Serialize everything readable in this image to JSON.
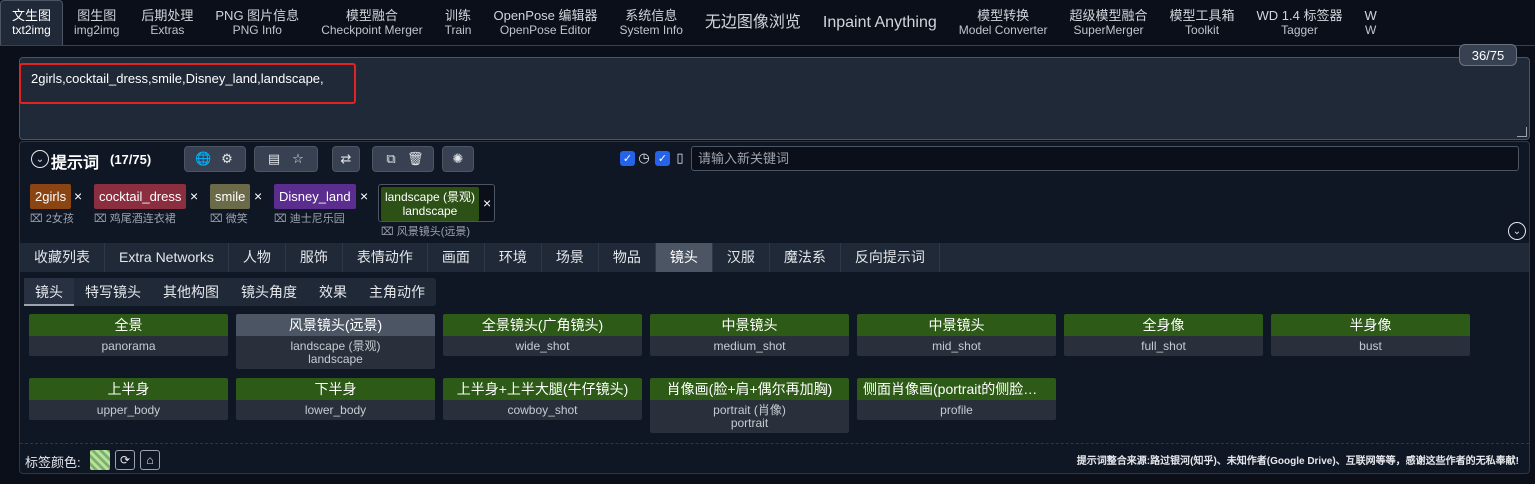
{
  "tabs": [
    {
      "l1": "文生图",
      "l2": "txt2img",
      "active": true
    },
    {
      "l1": "图生图",
      "l2": "img2img"
    },
    {
      "l1": "后期处理",
      "l2": "Extras"
    },
    {
      "l1": "PNG 图片信息",
      "l2": "PNG Info"
    },
    {
      "l1": "模型融合",
      "l2": "Checkpoint Merger"
    },
    {
      "l1": "训练",
      "l2": "Train"
    },
    {
      "l1": "OpenPose 编辑器",
      "l2": "OpenPose Editor"
    },
    {
      "l1": "系统信息",
      "l2": "System Info"
    },
    {
      "l1": "无边图像浏览",
      "l2": ""
    },
    {
      "l1": "Inpaint Anything",
      "l2": ""
    },
    {
      "l1": "模型转换",
      "l2": "Model Converter"
    },
    {
      "l1": "超级模型融合",
      "l2": "SuperMerger"
    },
    {
      "l1": "模型工具箱",
      "l2": "Toolkit"
    },
    {
      "l1": "WD 1.4 标签器",
      "l2": "Tagger"
    },
    {
      "l1": "W",
      "l2": "W"
    }
  ],
  "prompt": {
    "text": "2girls,cocktail_dress,smile,Disney_land,landscape,",
    "token_count": "36/75"
  },
  "helper": {
    "title": "提示词",
    "count": "(17/75)",
    "new_keyword_placeholder": "请输入新关键词"
  },
  "tags": [
    {
      "text": "2girls",
      "translation": "2女孩",
      "color": "#8b4513"
    },
    {
      "text": "cocktail_dress",
      "translation": "鸡尾酒连衣裙",
      "color": "#8b2e3f"
    },
    {
      "text": "smile",
      "translation": "微笑",
      "color": "#6b6b4a"
    },
    {
      "text": "Disney_land",
      "translation": "迪士尼乐园",
      "color": "#5b2d8e"
    }
  ],
  "big_tag": {
    "line1": "landscape (景观)",
    "line2": "landscape",
    "translation": "风景镜头(远景)"
  },
  "categories": [
    "收藏列表",
    "Extra Networks",
    "人物",
    "服饰",
    "表情动作",
    "画面",
    "环境",
    "场景",
    "物品",
    "镜头",
    "汉服",
    "魔法系",
    "反向提示词"
  ],
  "subcategories": [
    "镜头",
    "特写镜头",
    "其他构图",
    "镜头角度",
    "效果",
    "主角动作"
  ],
  "cards": [
    {
      "title": "全景",
      "desc": "panorama"
    },
    {
      "title": "风景镜头(远景)",
      "desc": "landscape (景观)",
      "desc2": "landscape",
      "selected": true
    },
    {
      "title": "全景镜头(广角镜头)",
      "desc": "wide_shot"
    },
    {
      "title": "中景镜头",
      "desc": "medium_shot"
    },
    {
      "title": "中景镜头",
      "desc": "mid_shot"
    },
    {
      "title": "全身像",
      "desc": "full_shot"
    },
    {
      "title": "半身像",
      "desc": "bust"
    },
    {
      "title": "上半身",
      "desc": "upper_body"
    },
    {
      "title": "下半身",
      "desc": "lower_body"
    },
    {
      "title": "上半身+上半大腿(牛仔镜头)",
      "desc": "cowboy_shot"
    },
    {
      "title": "肖像画(脸+肩+偶尔再加胸)",
      "desc": "portrait (肖像)",
      "desc2": "portrait"
    },
    {
      "title": "侧面肖像画(portrait的侧脸版本)",
      "desc": "profile"
    }
  ],
  "footer": {
    "label": "标签颜色:",
    "credit": "提示词整合来源:路过银河(知乎)、未知作者(Google Drive)、互联网等等，感谢这些作者的无私奉献!"
  },
  "colors": {
    "accent": "#2563eb",
    "card_green": "#2d5a16",
    "highlight": "#e02424"
  }
}
